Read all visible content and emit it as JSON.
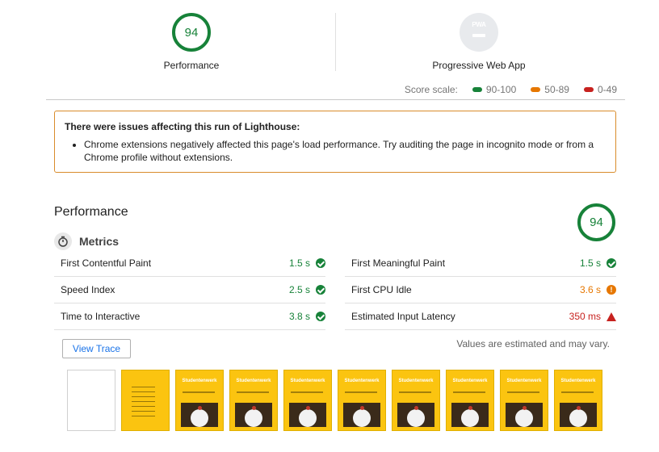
{
  "gauges": [
    {
      "score": "94",
      "label": "Performance"
    },
    {
      "label": "Progressive Web App",
      "badge": "PWA"
    }
  ],
  "score_scale": {
    "label": "Score scale:",
    "ranges": [
      {
        "text": "90-100",
        "color": "#178239"
      },
      {
        "text": "50-89",
        "color": "#e67700"
      },
      {
        "text": "0-49",
        "color": "#c7221f"
      }
    ]
  },
  "warning": {
    "title": "There were issues affecting this run of Lighthouse:",
    "items": [
      "Chrome extensions negatively affected this page's load performance. Try auditing the page in incognito mode or from a Chrome profile without extensions."
    ]
  },
  "performance": {
    "title": "Performance",
    "score": "94",
    "metrics_title": "Metrics",
    "metrics": [
      {
        "name": "First Contentful Paint",
        "value": "1.5 s",
        "status": "pass"
      },
      {
        "name": "First Meaningful Paint",
        "value": "1.5 s",
        "status": "pass"
      },
      {
        "name": "Speed Index",
        "value": "2.5 s",
        "status": "pass"
      },
      {
        "name": "First CPU Idle",
        "value": "3.6 s",
        "status": "average"
      },
      {
        "name": "Time to Interactive",
        "value": "3.8 s",
        "status": "pass"
      },
      {
        "name": "Estimated Input Latency",
        "value": "350 ms",
        "status": "fail"
      }
    ],
    "view_trace_label": "View Trace",
    "estimated_note": "Values are estimated and may vary.",
    "filmstrip": {
      "frames": 10,
      "brand_text": "Studentenwerk"
    }
  },
  "colors": {
    "pass": "#178239",
    "average": "#e67700",
    "fail": "#c7221f",
    "warning_border": "#d98c2b",
    "link": "#1a73e8",
    "frame_yellow": "#fbc410"
  }
}
